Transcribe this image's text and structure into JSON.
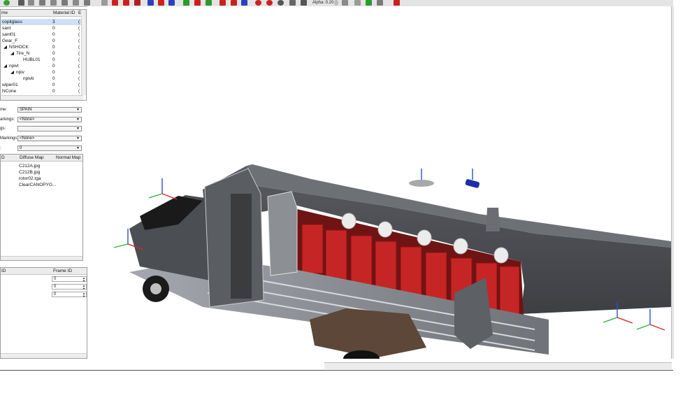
{
  "toolbar": {
    "alpha_label": "Alpha: 0.20",
    "colors": {
      "accent_red": "#cc1f1f",
      "accent_green": "#2a9a2a",
      "accent_blue": "#2d3fbf"
    }
  },
  "object_tree": {
    "columns": [
      "me",
      "Material ID",
      "E"
    ],
    "rows": [
      {
        "name": "copitglass",
        "material_id": "3",
        "extra": "("
      },
      {
        "name": "sant",
        "material_id": "0",
        "extra": "("
      },
      {
        "name": "sant01",
        "material_id": "0",
        "extra": "("
      },
      {
        "name": "Gear_F",
        "material_id": "0",
        "extra": "("
      },
      {
        "name": "NSHOCK",
        "material_id": "0",
        "extra": "("
      },
      {
        "name": "Tire_N",
        "material_id": "0",
        "extra": "("
      },
      {
        "name": "HUBL01",
        "material_id": "0",
        "extra": "("
      },
      {
        "name": "npivt",
        "material_id": "0",
        "extra": "("
      },
      {
        "name": "npiv",
        "material_id": "0",
        "extra": "("
      },
      {
        "name": "npivb",
        "material_id": "0",
        "extra": "("
      },
      {
        "name": "wiper01",
        "material_id": "0",
        "extra": "("
      },
      {
        "name": "NCone",
        "material_id": "0",
        "extra": "("
      }
    ]
  },
  "properties": {
    "fields": [
      {
        "label": "me:",
        "value": "SPAIN"
      },
      {
        "label": "arkings:",
        "value": "<None>"
      },
      {
        "label": "gs:",
        "value": ""
      },
      {
        "label": "Markings:",
        "value": "<None>"
      },
      {
        "label": ":",
        "value": "0"
      }
    ]
  },
  "textures": {
    "columns": [
      "D",
      "Diffuse Map",
      "Normal Map"
    ],
    "rows": [
      "C212A.jpg",
      "C212B.jpg",
      "rotor02.tga",
      "ClearCANOPYG..."
    ]
  },
  "frames": {
    "columns": [
      "ID",
      "Frame ID"
    ],
    "rows": [
      "0",
      "0",
      "0"
    ]
  }
}
